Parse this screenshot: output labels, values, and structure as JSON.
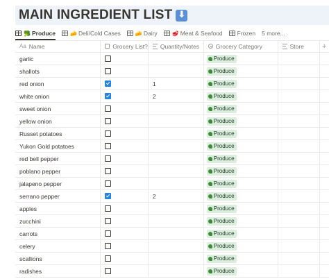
{
  "page": {
    "title": "MAIN INGREDIENT LIST"
  },
  "tabs": [
    {
      "label": "Produce",
      "emoji": "🥦"
    },
    {
      "label": "Deli/Cold Cases",
      "emoji": "🧀"
    },
    {
      "label": "Dairy",
      "emoji": "🧀"
    },
    {
      "label": "Meat & Seafood",
      "emoji": "🥩"
    },
    {
      "label": "Frozen"
    },
    {
      "label": "5 more..."
    }
  ],
  "columns": {
    "name": "Name",
    "grocery": "Grocery List?",
    "quantity": "Quantity/Notes",
    "category": "Grocery Category",
    "store": "Store",
    "add": "+"
  },
  "rows": [
    {
      "name": "garlic",
      "checked": false,
      "qty": "",
      "category": "Produce"
    },
    {
      "name": "shallots",
      "checked": false,
      "qty": "",
      "category": "Produce"
    },
    {
      "name": "red onion",
      "checked": true,
      "qty": "1",
      "category": "Produce"
    },
    {
      "name": "white onion",
      "checked": true,
      "qty": "2",
      "category": "Produce"
    },
    {
      "name": "sweet onion",
      "checked": false,
      "qty": "",
      "category": "Produce"
    },
    {
      "name": "yellow onion",
      "checked": false,
      "qty": "",
      "category": "Produce"
    },
    {
      "name": "Russet potatoes",
      "checked": false,
      "qty": "",
      "category": "Produce"
    },
    {
      "name": "Yukon Gold potatoes",
      "checked": false,
      "qty": "",
      "category": "Produce"
    },
    {
      "name": "red bell pepper",
      "checked": false,
      "qty": "",
      "category": "Produce"
    },
    {
      "name": "poblano pepper",
      "checked": false,
      "qty": "",
      "category": "Produce"
    },
    {
      "name": "jalapeno pepper",
      "checked": false,
      "qty": "",
      "category": "Produce"
    },
    {
      "name": "serrano pepper",
      "checked": true,
      "qty": "2",
      "category": "Produce"
    },
    {
      "name": "apples",
      "checked": false,
      "qty": "",
      "category": "Produce"
    },
    {
      "name": "zucchini",
      "checked": false,
      "qty": "",
      "category": "Produce"
    },
    {
      "name": "carrots",
      "checked": false,
      "qty": "",
      "category": "Produce"
    },
    {
      "name": "celery",
      "checked": false,
      "qty": "",
      "category": "Produce"
    },
    {
      "name": "scallions",
      "checked": false,
      "qty": "",
      "category": "Produce"
    },
    {
      "name": "radishes",
      "checked": false,
      "qty": "",
      "category": "Produce"
    }
  ],
  "colors": {
    "tag_bg": "#dbeddb",
    "checked": "#2383e2",
    "title_bg": "#eef3f9"
  }
}
